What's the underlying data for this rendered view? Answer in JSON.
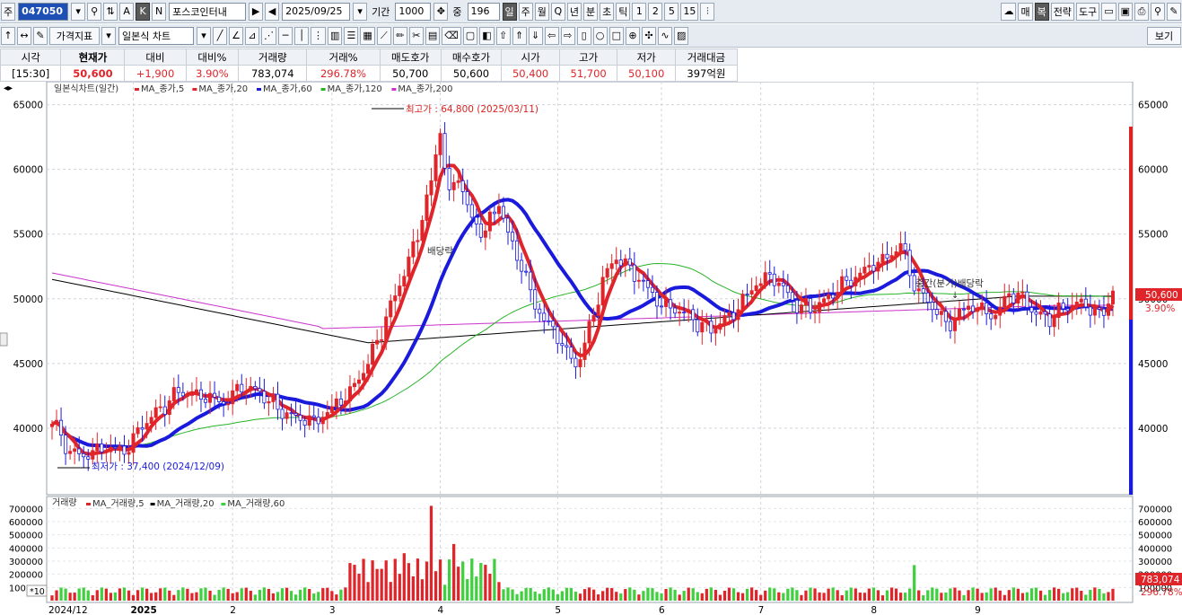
{
  "toolbar1": {
    "tab_label": "주",
    "stock_code": "047050",
    "stock_name": "포스코인터내",
    "date": "2025/09/25",
    "period_label": "기간",
    "period_value": "1000",
    "count_label": "중",
    "count_value": "196",
    "intervals": [
      "일",
      "주",
      "월",
      "Q",
      "년",
      "분",
      "초",
      "틱",
      "1",
      "2",
      "5",
      "15"
    ],
    "right_buttons": [
      "매",
      "복",
      "전략",
      "도구"
    ]
  },
  "toolbar2": {
    "indicator_button": "가격지표",
    "chart_type": "일본식 차트",
    "view_button": "보기"
  },
  "quote": {
    "headers": [
      "시각",
      "현재가",
      "대비",
      "대비%",
      "거래량",
      "거래%",
      "매도호가",
      "매수호가",
      "시가",
      "고가",
      "저가",
      "거래대금"
    ],
    "values": [
      "[15:30]",
      "50,600",
      "+1,900",
      "3.90%",
      "783,074",
      "296.78%",
      "50,700",
      "50,600",
      "50,400",
      "51,700",
      "50,100",
      "397억원"
    ]
  },
  "price_panel": {
    "legend_title": "일본식차트(일간)",
    "ma_legend": [
      "MA_종가,5",
      "MA_종가,20",
      "MA_종가,60",
      "MA_종가,120",
      "MA_종가,200"
    ],
    "ma_colors": [
      "#e0252a",
      "#e0252a",
      "#1a1adc",
      "#27b327",
      "#000000",
      "#cc33cc"
    ],
    "high_label": "최고가 : 64,800 (2025/03/11)",
    "low_label": "최저가 : 37,400 (2024/12/09)",
    "annotation_dividend1": "배당락",
    "annotation_dividend2": "중간(분기)배당락",
    "current_price_tag": "50,600",
    "current_change_tag": "3.90%"
  },
  "volume_panel": {
    "legend_title": "거래량",
    "ma_legend": [
      "MA_거래량,5",
      "MA_거래량,20",
      "MA_거래량,60"
    ],
    "current_volume_tag": "783,074",
    "current_volume_pct_tag": "296.78%",
    "unit_label": "*10"
  },
  "chart_data": {
    "type": "candlestick",
    "x_labels": [
      "2024/12",
      "2025",
      "2",
      "3",
      "4",
      "5",
      "6",
      "7",
      "8",
      "9"
    ],
    "price_axis": {
      "ticks": [
        40000,
        45000,
        50000,
        55000,
        60000,
        65000
      ],
      "ylim": [
        35000,
        66500
      ]
    },
    "volume_axis": {
      "ticks": [
        100000,
        200000,
        300000,
        400000,
        500000,
        600000,
        700000
      ],
      "ylim": [
        0,
        750000
      ]
    },
    "close_series": {
      "name": "종가",
      "points": [
        [
          0,
          40500
        ],
        [
          4,
          38200
        ],
        [
          7,
          37800
        ],
        [
          11,
          38500
        ],
        [
          16,
          38200
        ],
        [
          20,
          40200
        ],
        [
          24,
          41500
        ],
        [
          28,
          42800
        ],
        [
          33,
          42500
        ],
        [
          38,
          42000
        ],
        [
          42,
          43200
        ],
        [
          46,
          42800
        ],
        [
          50,
          41500
        ],
        [
          54,
          40800
        ],
        [
          58,
          40500
        ],
        [
          62,
          41500
        ],
        [
          66,
          42800
        ],
        [
          70,
          45000
        ],
        [
          74,
          48500
        ],
        [
          78,
          52000
        ],
        [
          81,
          55000
        ],
        [
          84,
          59000
        ],
        [
          86,
          63000
        ],
        [
          88,
          58000
        ],
        [
          90,
          59500
        ],
        [
          93,
          56000
        ],
        [
          96,
          55200
        ],
        [
          99,
          57500
        ],
        [
          101,
          55000
        ],
        [
          104,
          52500
        ],
        [
          107,
          49500
        ],
        [
          110,
          48000
        ],
        [
          113,
          46500
        ],
        [
          116,
          44800
        ],
        [
          119,
          47500
        ],
        [
          122,
          51500
        ],
        [
          125,
          53200
        ],
        [
          128,
          52300
        ],
        [
          131,
          51200
        ],
        [
          134,
          49800
        ],
        [
          137,
          49300
        ],
        [
          140,
          48900
        ],
        [
          143,
          48200
        ],
        [
          146,
          47500
        ],
        [
          148,
          48200
        ],
        [
          150,
          48600
        ],
        [
          153,
          49800
        ],
        [
          156,
          51200
        ],
        [
          159,
          51800
        ],
        [
          162,
          50800
        ],
        [
          165,
          49500
        ],
        [
          168,
          49200
        ],
        [
          171,
          49800
        ],
        [
          174,
          50800
        ],
        [
          177,
          51500
        ],
        [
          180,
          52200
        ],
        [
          183,
          52800
        ],
        [
          186,
          53500
        ],
        [
          188,
          54200
        ],
        [
          190,
          52000
        ],
        [
          192,
          50500
        ],
        [
          194,
          49800
        ],
        [
          196,
          49000
        ],
        [
          198,
          48000
        ],
        [
          200,
          48500
        ],
        [
          203,
          49400
        ],
        [
          206,
          49200
        ],
        [
          209,
          48600
        ],
        [
          212,
          50500
        ],
        [
          215,
          50000
        ],
        [
          218,
          48800
        ],
        [
          221,
          48500
        ],
        [
          224,
          49200
        ],
        [
          227,
          49800
        ],
        [
          230,
          49200
        ],
        [
          233,
          48800
        ],
        [
          235,
          50600
        ]
      ]
    },
    "volume_highlights": {
      "max_bar": 720000,
      "last_bar": 783074
    }
  }
}
